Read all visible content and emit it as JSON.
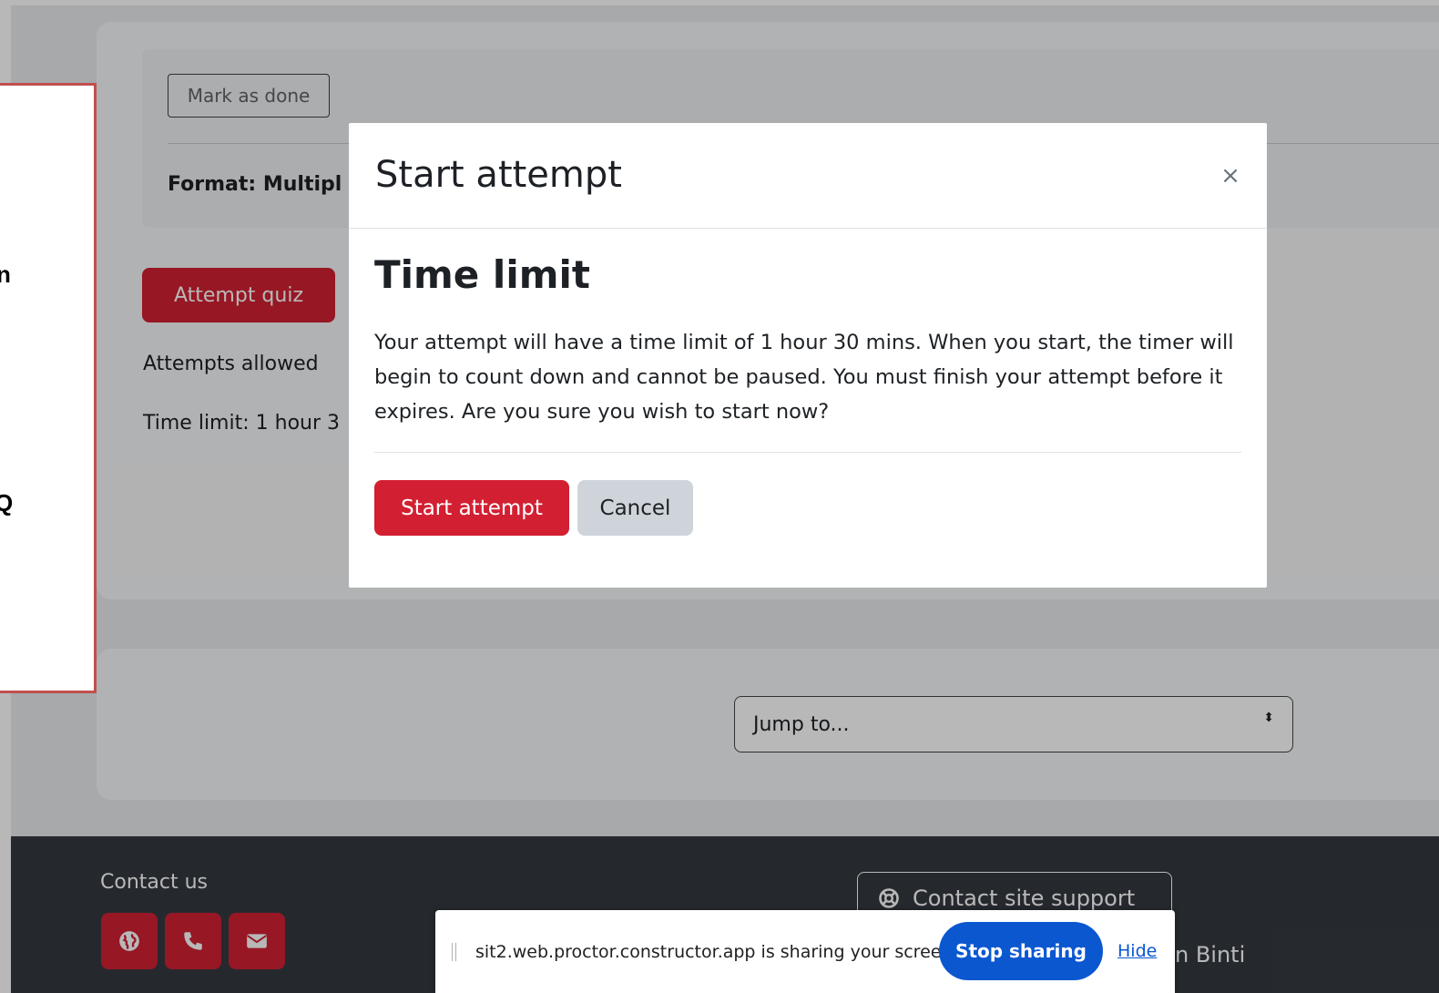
{
  "course_card": {
    "mark_done_label": "Mark as done",
    "format_text": "Format: Multipl",
    "attempt_quiz_label": "Attempt quiz",
    "attempts_allowed_text": "Attempts allowed",
    "time_limit_text": "Time limit: 1 hour 3"
  },
  "navigation": {
    "jump_to_placeholder": "Jump to...",
    "jump_caret": "⬍"
  },
  "annotation": {
    "lines": [
      "n",
      "Q"
    ]
  },
  "modal": {
    "title": "Start attempt",
    "close_glyph": "×",
    "heading": "Time limit",
    "body": "Your attempt will have a time limit of 1 hour 30 mins. When you start, the timer will begin to count down and cannot be paused. You must finish your attempt before it expires. Are you sure you wish to start now?",
    "start_label": "Start attempt",
    "cancel_label": "Cancel"
  },
  "footer": {
    "contact_us": "Contact us",
    "social_icons": [
      "globe-icon",
      "phone-icon",
      "envelope-icon"
    ],
    "support_label": "Contact site support",
    "name_fragment": "n Binti"
  },
  "screen_share": {
    "message": "sit2.web.proctor.constructor.app is sharing your screen.",
    "stop_label": "Stop sharing",
    "hide_label": "Hide"
  },
  "colors": {
    "brand_red": "#d22032",
    "share_blue": "#0b57d0",
    "footer_bg": "#343a40",
    "annotation_border": "#c0504d"
  }
}
